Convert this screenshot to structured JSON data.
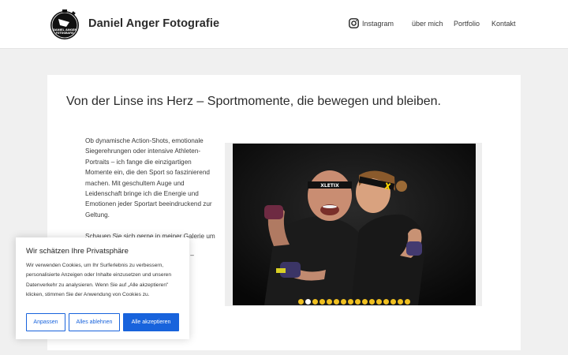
{
  "header": {
    "site_title": "Daniel Anger Fotografie",
    "logo_text": "DANIEL ANGER FOTOGRAFIE",
    "nav": {
      "instagram": "Instagram",
      "ueber_mich": "über mich",
      "portfolio": "Portfolio",
      "kontakt": "Kontakt"
    }
  },
  "main": {
    "headline": "Von der Linse ins Herz – Sportmomente, die bewegen und bleiben.",
    "paragraph1": "Ob dynamische Action-Shots, emotionale Siegerehrungen oder intensive Athleten-Portraits – ich fange die einzigartigen Momente ein, die den Sport so faszinierend machen. Mit geschultem Auge und Leidenschaft bringe ich die Energie und Emotionen jeder Sportart beeindruckend zur Geltung.",
    "paragraph2_line1": "Schauen Sie sich gerne in meiner Galerie um",
    "paragraph2_line2_tail": "eten –",
    "slider": {
      "slide_count": 16,
      "active_index": 1,
      "headband_text_left": "XLETIX",
      "headband_text_right": "XLETIX"
    }
  },
  "cookie": {
    "title": "Wir schätzen Ihre Privatsphäre",
    "text": "Wir verwenden Cookies, um Ihr Surferlebnis zu verbessern, personalisierte Anzeigen oder Inhalte einzusetzen und unseren Datenverkehr zu analysieren. Wenn Sie auf „Alle akzeptieren\" klicken, stimmen Sie der Anwendung von Cookies zu.",
    "btn_customize": "Anpassen",
    "btn_reject": "Alles ablehnen",
    "btn_accept": "Alle akzeptieren"
  },
  "colors": {
    "accent": "#1863dc",
    "dot_yellow": "#f0c020",
    "background": "#f0f0f0"
  }
}
